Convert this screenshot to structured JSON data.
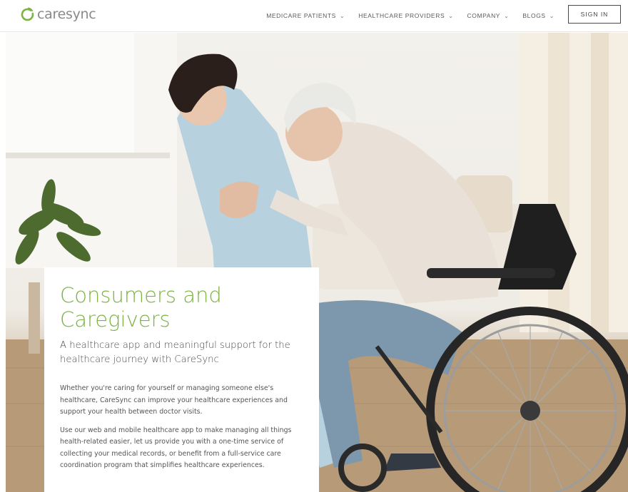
{
  "header": {
    "logo_text": "caresync",
    "nav": [
      {
        "label": "MEDICARE PATIENTS"
      },
      {
        "label": "HEALTHCARE PROVIDERS"
      },
      {
        "label": "COMPANY"
      },
      {
        "label": "BLOGS"
      }
    ],
    "signin_label": "SIGN IN"
  },
  "hero": {
    "card": {
      "title": "Consumers and Caregivers",
      "subtitle": "A healthcare app and meaningful support for the healthcare journey with CareSync",
      "paragraphs": [
        "Whether you're caring for yourself or managing someone else's healthcare, CareSync can improve your healthcare experiences and support your health between doctor visits.",
        "Use our web and mobile healthcare app to make managing all things health-related easier, let us provide you with a one-time service of collecting your medical records, or benefit from a full-service care coordination program that simplifies healthcare experiences."
      ]
    }
  },
  "colors": {
    "brand_green": "#7cb342",
    "logo_gray": "#8a8a8a",
    "nav_text": "#5a5a5a"
  },
  "icons": {
    "logo_mark": "caresync-logo-icon",
    "nav_chevron": "chevron-down-icon"
  }
}
